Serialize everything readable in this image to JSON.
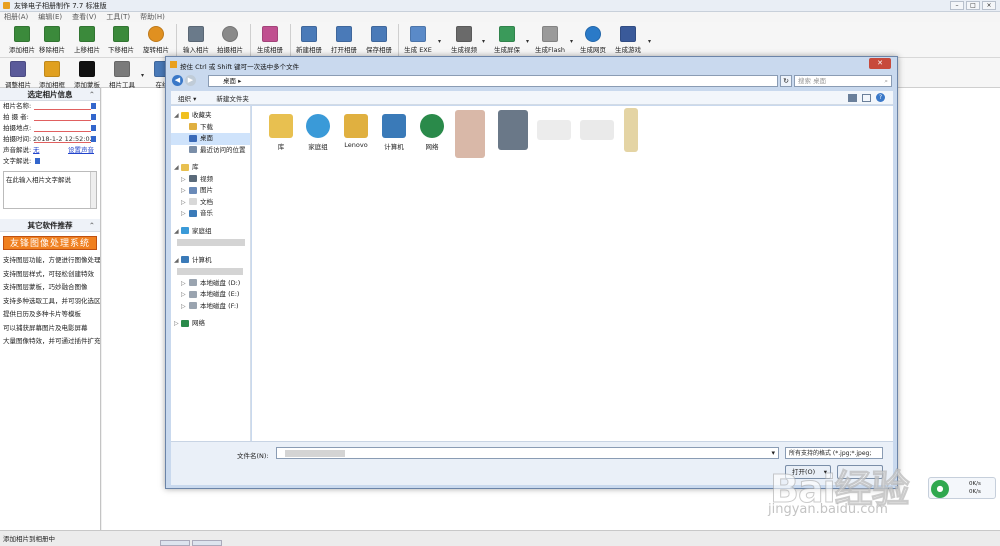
{
  "app": {
    "title": "友锋电子相册制作 7.7 标准版"
  },
  "menu": [
    "相册(A)",
    "编辑(E)",
    "查看(V)",
    "工具(T)",
    "帮助(H)"
  ],
  "toolbar1": [
    {
      "label": "添加相片",
      "icon": "add-photo-icon",
      "color": "#3b8a3b"
    },
    {
      "label": "移除相片",
      "icon": "remove-photo-icon",
      "color": "#3b8a3b"
    },
    {
      "label": "上移相片",
      "icon": "move-up-icon",
      "color": "#3b8a3b"
    },
    {
      "label": "下移相片",
      "icon": "move-down-icon",
      "color": "#3b8a3b"
    },
    {
      "label": "旋转相片",
      "icon": "rotate-icon",
      "color": "#e09020"
    },
    {
      "label": "输入相片",
      "icon": "import-photo-icon",
      "color": "#6a7a8a"
    },
    {
      "label": "拍摄相片",
      "icon": "camera-icon",
      "color": "#8a8a8a"
    },
    {
      "label": "生成相册",
      "icon": "make-album-icon",
      "color": "#c05090"
    },
    {
      "label": "新建相册",
      "icon": "new-album-icon",
      "color": "#4a7ab8"
    },
    {
      "label": "打开相册",
      "icon": "open-album-icon",
      "color": "#4a7ab8"
    },
    {
      "label": "保存相册",
      "icon": "save-album-icon",
      "color": "#4a7ab8"
    },
    {
      "label": "生成 EXE",
      "icon": "exe-icon",
      "color": "#5a8ac8"
    },
    {
      "label": "生成视频",
      "icon": "video-icon",
      "color": "#6a6a6a"
    },
    {
      "label": "生成屏保",
      "icon": "screensaver-icon",
      "color": "#3a9a5a"
    },
    {
      "label": "生成Flash",
      "icon": "flash-icon",
      "color": "#9a9a9a"
    },
    {
      "label": "生成网页",
      "icon": "webpage-icon",
      "color": "#2a7ac8"
    },
    {
      "label": "生成游戏",
      "icon": "game-icon",
      "color": "#3a5a9a"
    }
  ],
  "toolbar2": [
    {
      "label": "调整相片",
      "icon": "adjust-photo-icon",
      "color": "#5a5a9a"
    },
    {
      "label": "添加相框",
      "icon": "add-frame-icon",
      "color": "#e0a020"
    },
    {
      "label": "添加蒙板",
      "icon": "add-mask-icon",
      "color": "#111111"
    },
    {
      "label": "相片工具",
      "icon": "photo-tools-icon",
      "color": "#7a7a7a"
    },
    {
      "label": "在线",
      "icon": "online-icon",
      "color": "#4a7ab8"
    }
  ],
  "left": {
    "info_title": "选定相片信息",
    "fields": {
      "name_label": "相片名称:",
      "author_label": "拍 摄 者:",
      "location_label": "拍摄地点:",
      "time_label": "拍摄时间:",
      "time_value": "2018-1-2 12:52:02",
      "voice_label": "声音解说:",
      "voice_value": "无",
      "voice_link": "设置声音",
      "text_label": "文字解说:"
    },
    "desc_placeholder": "在此输入相片文字解说",
    "rec_title": "其它软件推荐",
    "banner": "友锋图像处理系统",
    "rec_items": [
      "支持图层功能，方便进行图像处理",
      "支持图层样式，可轻松创建特效",
      "支持图层蒙板，巧妙融合图像",
      "支持多种选取工具，并可羽化选区",
      "提供日历及多种卡片等模板",
      "可以捕获屏幕图片及电影屏幕",
      "大量图像特效，并可通过插件扩充"
    ]
  },
  "status": {
    "text": "添加相片到相册中"
  },
  "dialog": {
    "title": "按住 Ctrl 或 Shift 键可一次选中多个文件",
    "address": "桌面",
    "search_placeholder": "搜索 桌面",
    "organize": "组织 ▾",
    "new_folder": "新建文件夹",
    "nav": {
      "favorites": "收藏夹",
      "downloads": "下载",
      "desktop": "桌面",
      "recent": "最近访问的位置",
      "libraries": "库",
      "videos": "视频",
      "pictures": "图片",
      "documents": "文档",
      "music": "音乐",
      "homegroup": "家庭组",
      "computer": "计算机",
      "disk_d": "本地磁盘 (D:)",
      "disk_e": "本地磁盘 (E:)",
      "disk_f": "本地磁盘 (F:)",
      "network": "网络"
    },
    "files": [
      {
        "label": "库",
        "icon": "library-icon",
        "color": "#e8c050"
      },
      {
        "label": "家庭组",
        "icon": "homegroup-icon",
        "color": "#3a9ad8"
      },
      {
        "label": "Lenovo",
        "icon": "user-folder-icon",
        "color": "#e0b040"
      },
      {
        "label": "计算机",
        "icon": "computer-icon",
        "color": "#3a7ab8"
      },
      {
        "label": "网络",
        "icon": "network-icon",
        "color": "#2a8a4a"
      }
    ],
    "filename_label": "文件名(N):",
    "filetype": "所有支持的格式 (*.jpg;*.jpeg;",
    "open_button": "打开(O)"
  },
  "tray": {
    "up": "0K/s",
    "down": "0K/s"
  },
  "watermark": {
    "brand": "Bai经验",
    "url": "jingyan.baidu.com"
  }
}
